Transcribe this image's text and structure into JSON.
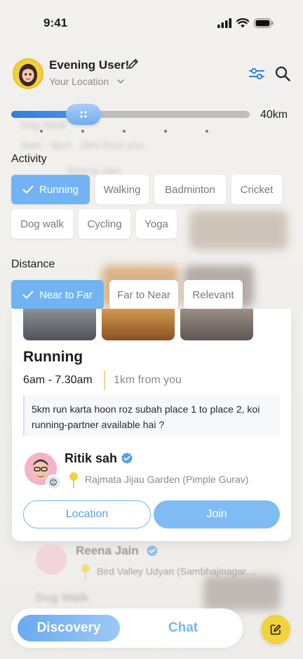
{
  "status_bar": {
    "time": "9:41"
  },
  "header": {
    "user_name": "Evening User!",
    "location": "Your Location"
  },
  "distance_slider": {
    "value_label": "40km",
    "fraction": 0.34
  },
  "activity": {
    "label": "Activity",
    "chips": [
      "Running",
      "Walking",
      "Badminton",
      "Cricket",
      "Dog walk",
      "Cycling",
      "Yoga"
    ],
    "selected": "Running"
  },
  "distance_sort": {
    "label": "Distance",
    "chips": [
      "Near to Far",
      "Far to Near",
      "Relevant"
    ],
    "selected": "Near to Far"
  },
  "card": {
    "title": "Running",
    "time": "6am - 7.30am",
    "distance": "1km from you",
    "description": "5km run karta hoon roz subah place 1 to place 2, koi running-partner available hai ?",
    "host_name": "Ritik sah",
    "host_location": "Rajmata Jijau Garden (Pimple Gurav)",
    "location_button": "Location",
    "join_button": "Join"
  },
  "next_card": {
    "host_name": "Reena Jain",
    "host_location": "Bird Valley Udyan (Sambhajinagar,...",
    "title": "Dog Walk"
  },
  "bottom_nav": {
    "discovery": "Discovery",
    "chat": "Chat"
  },
  "colors": {
    "accent": "#72b4f3",
    "brand_yellow": "#f3d33c",
    "slider_blue": "#2f7fe0"
  }
}
